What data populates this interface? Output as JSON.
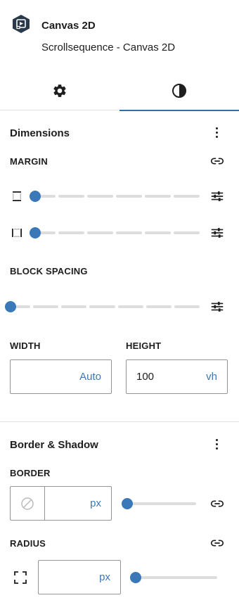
{
  "block": {
    "icon": "canvas-block-icon",
    "title": "Canvas 2D",
    "description": "Scrollsequence - Canvas 2D"
  },
  "tabs": [
    {
      "name": "settings",
      "icon": "gear-icon",
      "active": false
    },
    {
      "name": "styles",
      "icon": "half-circle-contrast-icon",
      "active": true
    }
  ],
  "dimensions": {
    "title": "Dimensions",
    "margin_label": "MARGIN",
    "margin_vertical": 0,
    "margin_horizontal": 0,
    "block_spacing_label": "BLOCK SPACING",
    "block_spacing": 0,
    "width_label": "WIDTH",
    "width_value": "",
    "width_unit": "Auto",
    "height_label": "HEIGHT",
    "height_value": "100",
    "height_unit": "vh"
  },
  "border_shadow": {
    "title": "Border & Shadow",
    "border_label": "BORDER",
    "border_value": "",
    "border_unit": "px",
    "border_slider": 0,
    "radius_label": "RADIUS",
    "radius_value": "",
    "radius_unit": "px",
    "radius_slider": 0
  },
  "colors": {
    "accent": "#3a78b8",
    "text": "#1e1e1e",
    "border": "#949494",
    "divider": "#e0e0e0",
    "track": "#dddddd"
  }
}
